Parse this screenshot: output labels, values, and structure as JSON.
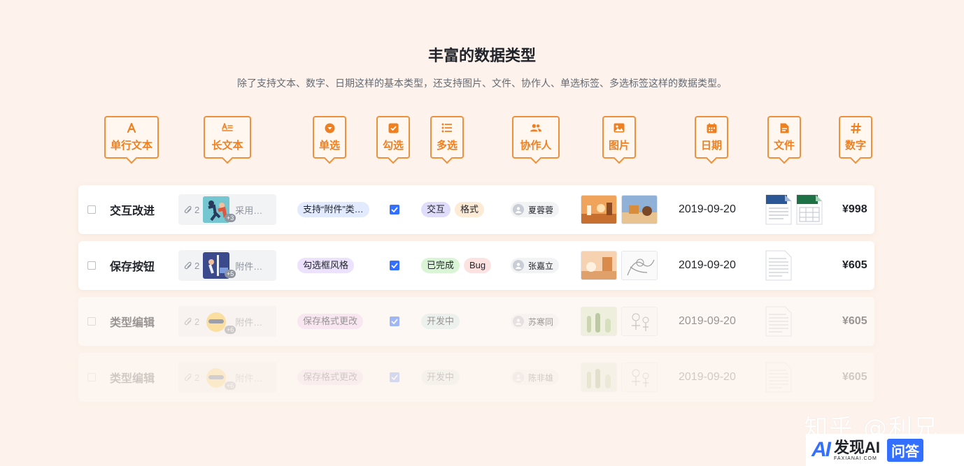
{
  "header": {
    "title": "丰富的数据类型",
    "subtitle": "除了支持文本、数字、日期这样的基本类型，还支持图片、文件、协作人、单选标签、多选标签这样的数据类型。"
  },
  "field_types": [
    {
      "label": "单行文本",
      "icon": "text-a-icon"
    },
    {
      "label": "长文本",
      "icon": "long-text-icon"
    },
    {
      "label": "单选",
      "icon": "single-select-icon"
    },
    {
      "label": "勾选",
      "icon": "checkbox-icon"
    },
    {
      "label": "多选",
      "icon": "list-icon"
    },
    {
      "label": "协作人",
      "icon": "people-icon"
    },
    {
      "label": "图片",
      "icon": "image-icon"
    },
    {
      "label": "日期",
      "icon": "calendar-icon"
    },
    {
      "label": "文件",
      "icon": "file-icon"
    },
    {
      "label": "数字",
      "icon": "hash-icon"
    }
  ],
  "rows": [
    {
      "name": "交互改进",
      "longtext": {
        "count": "2",
        "badge": "+3",
        "text": "采用…"
      },
      "single": {
        "label": "支持“附件”类…",
        "color": "#e1eaff",
        "text_color": "#1f2329"
      },
      "checked": true,
      "multi": [
        {
          "label": "交互",
          "color": "#e0dcfb",
          "text_color": "#1f2329"
        },
        {
          "label": "格式",
          "color": "#fdebd6",
          "text_color": "#1f2329"
        }
      ],
      "collaborator": "夏蓉蓉",
      "date": "2019-09-20",
      "number": "¥998"
    },
    {
      "name": "保存按钮",
      "longtext": {
        "count": "2",
        "badge": "+5",
        "text": "附件…"
      },
      "single": {
        "label": "勾选框风格",
        "color": "#ece2fe",
        "text_color": "#1f2329"
      },
      "checked": true,
      "multi": [
        {
          "label": "已完成",
          "color": "#d9f5d6",
          "text_color": "#1f2329"
        },
        {
          "label": "Bug",
          "color": "#fde2e2",
          "text_color": "#1f2329"
        }
      ],
      "collaborator": "张嘉立",
      "date": "2019-09-20",
      "number": "¥605"
    },
    {
      "name": "类型编辑",
      "longtext": {
        "count": "2",
        "badge": "+6",
        "text": "附件…"
      },
      "single": {
        "label": "保存格式更改",
        "color": "#f3d9f7",
        "text_color": "#1f2329"
      },
      "checked": true,
      "multi": [
        {
          "label": "开发中",
          "color": "#d9f0f0",
          "text_color": "#1f2329"
        }
      ],
      "collaborator": "苏寒同",
      "date": "2019-09-20",
      "number": "¥605"
    },
    {
      "name": "类型编辑",
      "longtext": {
        "count": "2",
        "badge": "+6",
        "text": "附件…"
      },
      "single": {
        "label": "保存格式更改",
        "color": "#f3d9f7",
        "text_color": "#1f2329"
      },
      "checked": true,
      "multi": [
        {
          "label": "开发中",
          "color": "#d9f0f0",
          "text_color": "#1f2329"
        }
      ],
      "collaborator": "陈非雄",
      "date": "2019-09-20",
      "number": "¥605"
    }
  ],
  "watermark": "知乎 @利兄",
  "brand": {
    "name": "发现AI",
    "sub": "FAXIANAI.COM",
    "box": "问答"
  },
  "colors": {
    "accent": "#f0903a",
    "primary": "#3370ff",
    "background": "#fdf3ec"
  }
}
